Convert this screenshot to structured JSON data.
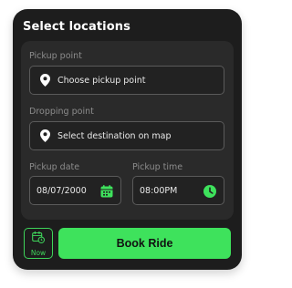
{
  "title": "Select locations",
  "pickup_point": {
    "label": "Pickup point",
    "placeholder": "Choose pickup point"
  },
  "dropping_point": {
    "label": "Dropping point",
    "placeholder": "Select destination on map"
  },
  "pickup_date": {
    "label": "Pickup date",
    "value": "08/07/2000"
  },
  "pickup_time": {
    "label": "Pickup time",
    "value": "08:00PM"
  },
  "now_button": {
    "label": "Now"
  },
  "book_button": {
    "label": "Book Ride"
  },
  "colors": {
    "accent": "#3ee25c",
    "card_bg": "#1d1d1d",
    "panel_bg": "#2a2a2a"
  },
  "icons": {
    "location": "map-pin-icon",
    "calendar": "calendar-icon",
    "clock": "clock-icon",
    "now": "calendar-clock-icon"
  }
}
